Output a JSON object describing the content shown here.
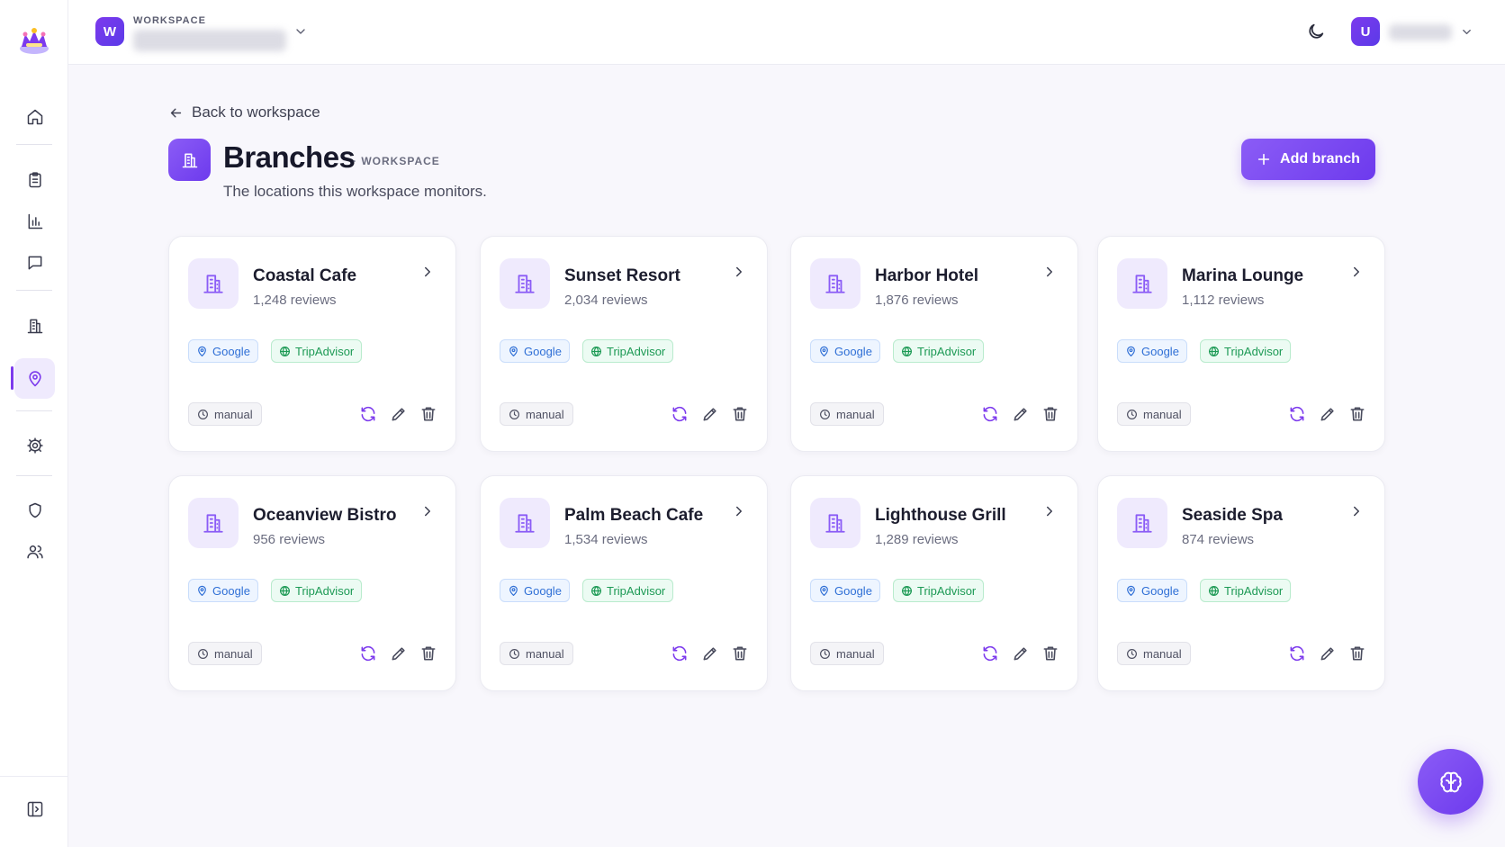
{
  "colors": {
    "accent": "#7c3aed",
    "google_badge": "#2f6fd6",
    "tripadvisor_badge": "#1d9a55",
    "page_background": "#f8f7fc"
  },
  "sidebar": {
    "icons": [
      "home-icon",
      "clipboard-icon",
      "bar-chart-icon",
      "message-icon",
      "building-icon",
      "map-pin-icon",
      "settings-icon",
      "shield-icon",
      "users-icon",
      "sidebar-toggle-icon"
    ],
    "active_item": "map-pin-icon"
  },
  "topbar": {
    "workspace_label": "WORKSPACE",
    "workspace_initial": "W",
    "user_initial": "U"
  },
  "header": {
    "back_label": "Back to workspace",
    "title": "Branches",
    "scope": "· WORKSPACE",
    "subtitle": "The locations this workspace monitors.",
    "add_button_label": "Add branch"
  },
  "branches": [
    {
      "name": "Coastal Cafe",
      "reviews": "1,248 reviews",
      "sources": [
        "Google",
        "TripAdvisor"
      ],
      "mode": "manual"
    },
    {
      "name": "Sunset Resort",
      "reviews": "2,034 reviews",
      "sources": [
        "Google",
        "TripAdvisor"
      ],
      "mode": "manual"
    },
    {
      "name": "Harbor Hotel",
      "reviews": "1,876 reviews",
      "sources": [
        "Google",
        "TripAdvisor"
      ],
      "mode": "manual"
    },
    {
      "name": "Marina Lounge",
      "reviews": "1,112 reviews",
      "sources": [
        "Google",
        "TripAdvisor"
      ],
      "mode": "manual"
    },
    {
      "name": "Oceanview Bistro",
      "reviews": "956 reviews",
      "sources": [
        "Google",
        "TripAdvisor"
      ],
      "mode": "manual"
    },
    {
      "name": "Palm Beach Cafe",
      "reviews": "1,534 reviews",
      "sources": [
        "Google",
        "TripAdvisor"
      ],
      "mode": "manual"
    },
    {
      "name": "Lighthouse Grill",
      "reviews": "1,289 reviews",
      "sources": [
        "Google",
        "TripAdvisor"
      ],
      "mode": "manual"
    },
    {
      "name": "Seaside Spa",
      "reviews": "874 reviews",
      "sources": [
        "Google",
        "TripAdvisor"
      ],
      "mode": "manual"
    }
  ]
}
